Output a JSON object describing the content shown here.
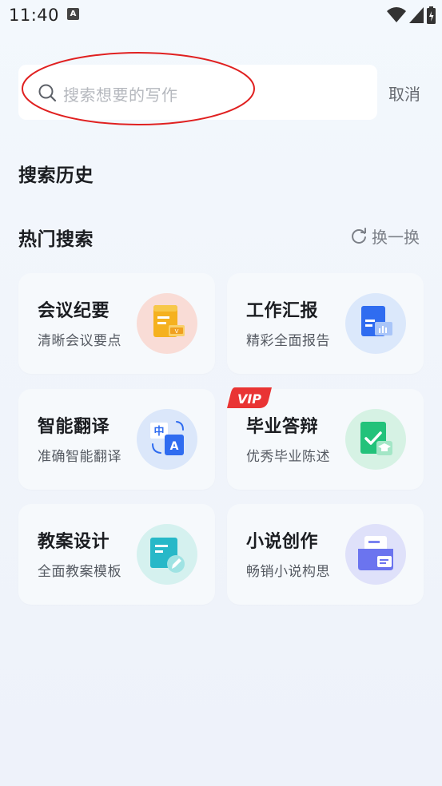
{
  "status_bar": {
    "time": "11:40",
    "notif_letter": "A"
  },
  "search": {
    "placeholder": "搜索想要的写作",
    "cancel_label": "取消"
  },
  "history": {
    "title": "搜索历史"
  },
  "hot": {
    "title": "热门搜索",
    "refresh_label": "换一换",
    "cards": [
      {
        "title": "会议纪要",
        "subtitle": "清晰会议要点",
        "icon": "meeting-notes-icon",
        "vip": false
      },
      {
        "title": "工作汇报",
        "subtitle": "精彩全面报告",
        "icon": "work-report-icon",
        "vip": false
      },
      {
        "title": "智能翻译",
        "subtitle": "准确智能翻译",
        "icon": "translate-icon",
        "vip": false
      },
      {
        "title": "毕业答辩",
        "subtitle": "优秀毕业陈述",
        "icon": "graduation-defense-icon",
        "vip": true,
        "vip_label": "VIP"
      },
      {
        "title": "教案设计",
        "subtitle": "全面教案模板",
        "icon": "lesson-plan-icon",
        "vip": false
      },
      {
        "title": "小说创作",
        "subtitle": "畅销小说构思",
        "icon": "novel-writing-icon",
        "vip": false
      }
    ]
  },
  "colors": {
    "accent_red": "#e03a3a",
    "annotation": "#e02020"
  }
}
